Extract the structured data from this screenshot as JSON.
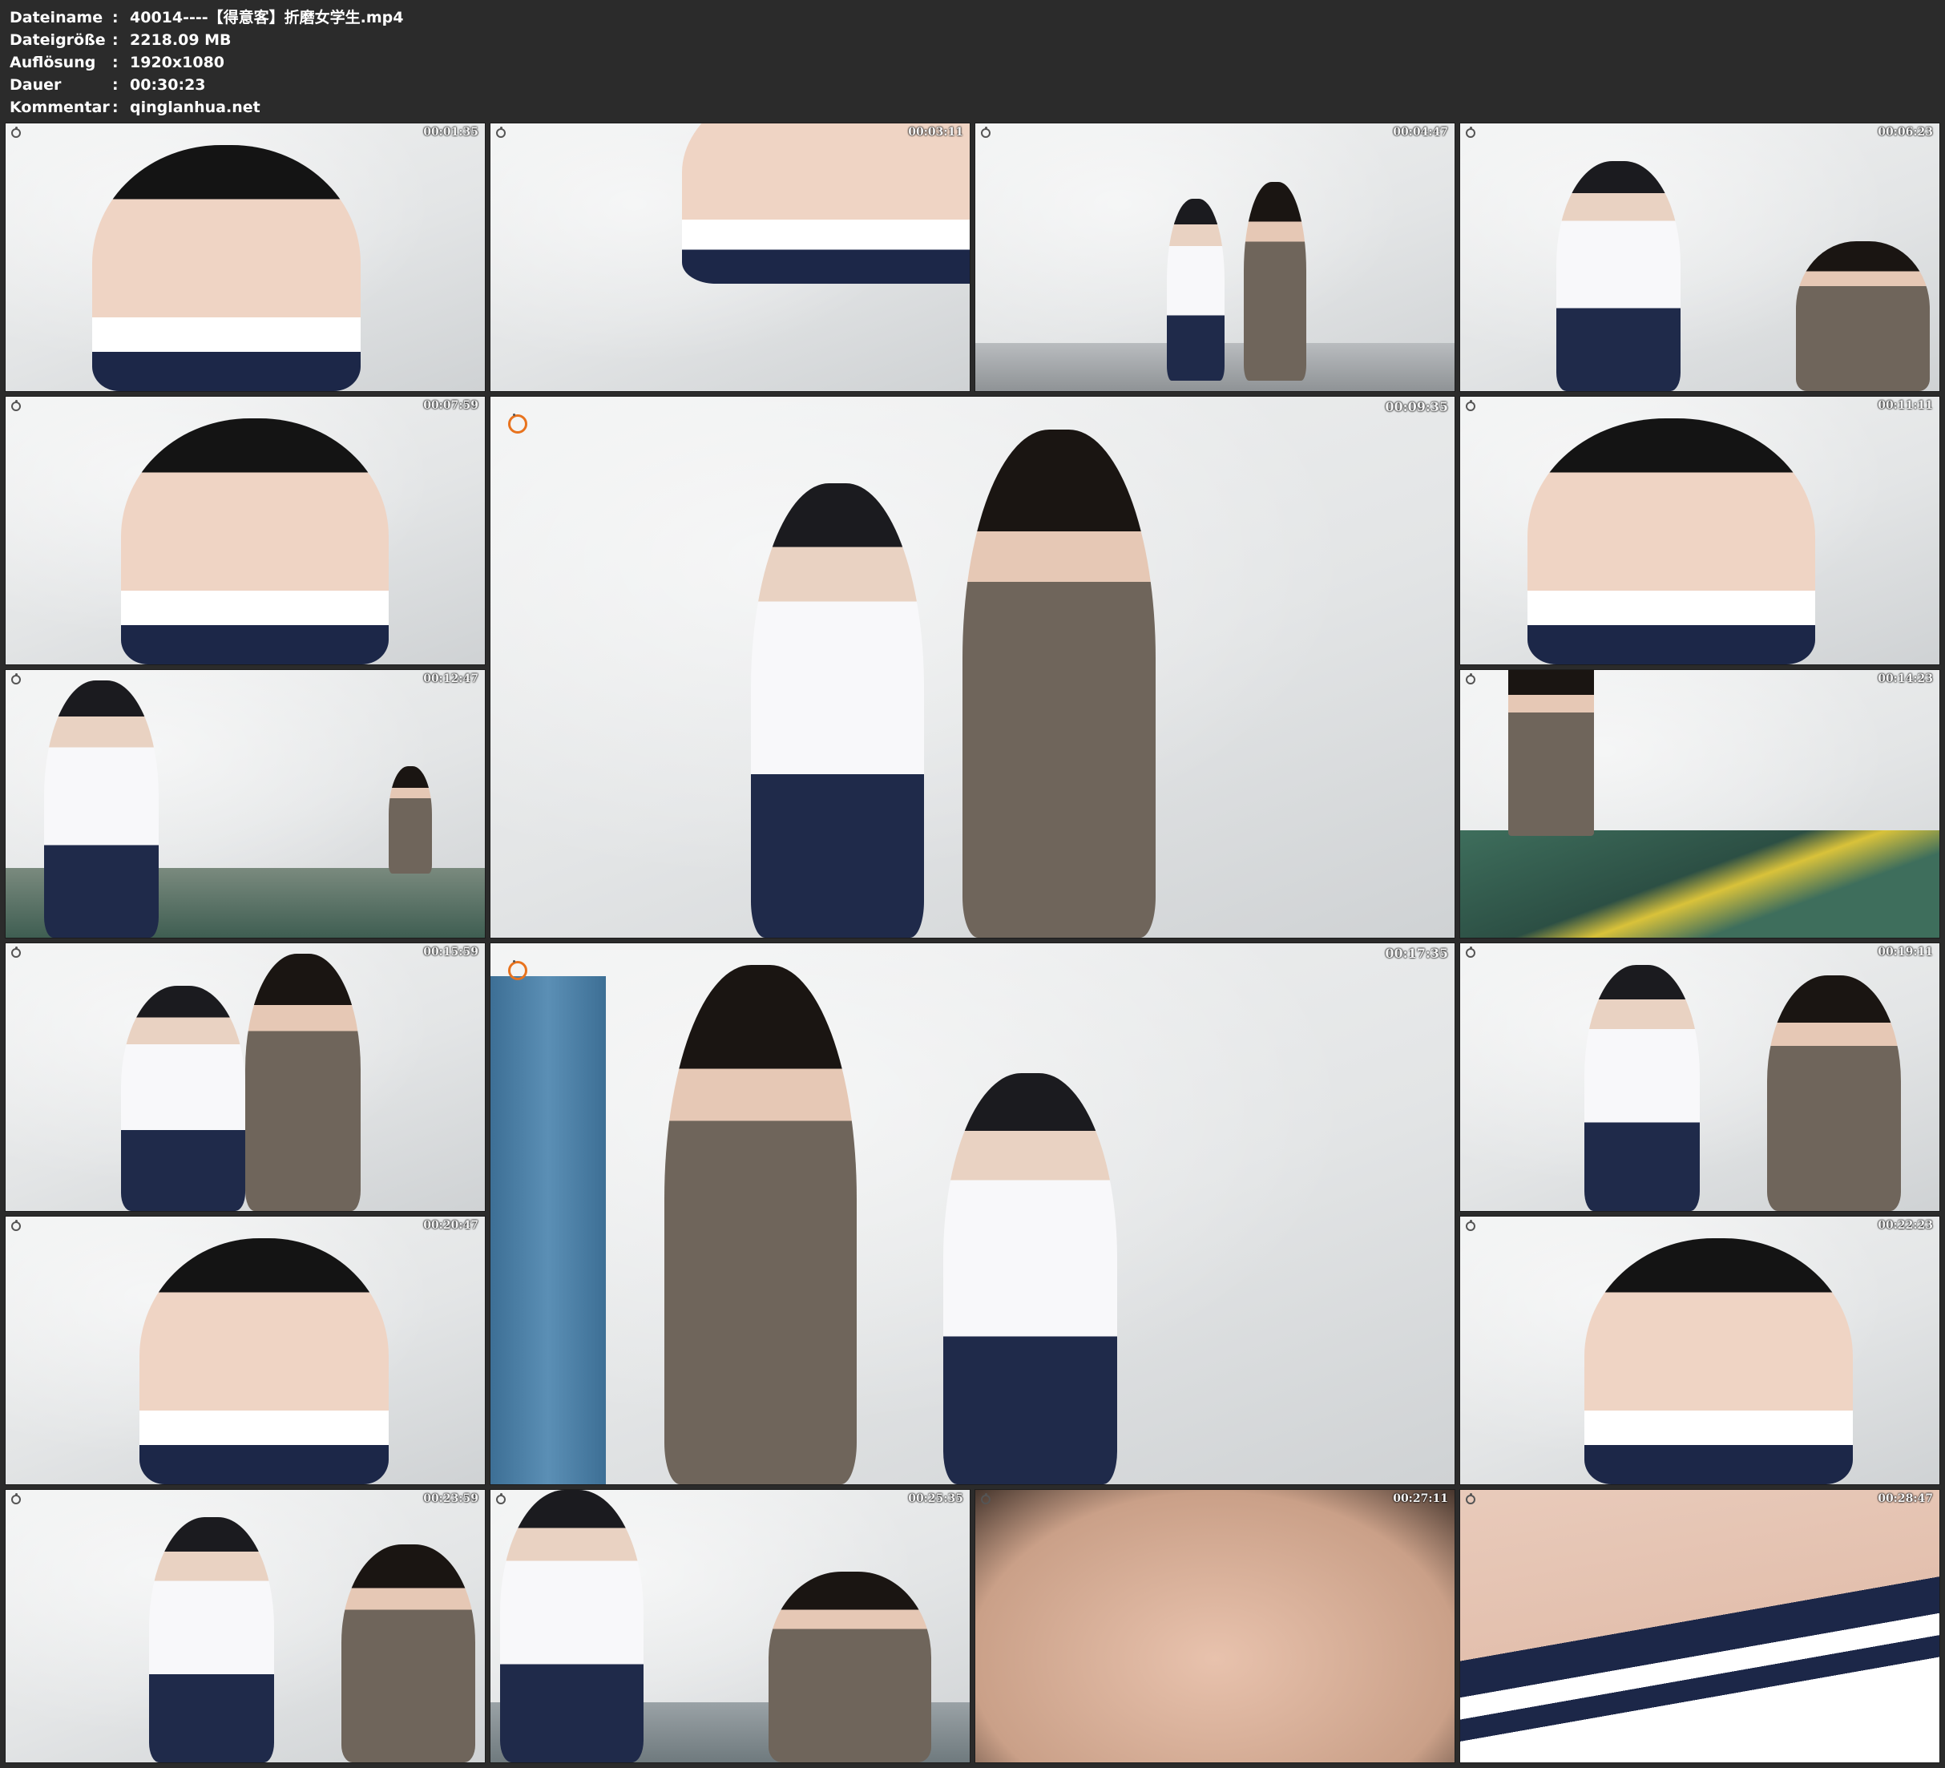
{
  "header": {
    "rows": [
      {
        "label": "Dateiname",
        "sep": ":",
        "value": "40014----【得意客】折磨女学生.mp4"
      },
      {
        "label": "Dateigröße",
        "sep": ":",
        "value": "2218.09 MB"
      },
      {
        "label": "Auflösung",
        "sep": ":",
        "value": "1920x1080"
      },
      {
        "label": "Dauer",
        "sep": ":",
        "value": "00:30:23"
      },
      {
        "label": "Kommentar",
        "sep": ":",
        "value": "qinglanhua.net"
      }
    ]
  },
  "thumbnails": [
    {
      "timestamp": "00:01:35"
    },
    {
      "timestamp": "00:03:11"
    },
    {
      "timestamp": "00:04:47"
    },
    {
      "timestamp": "00:06:23"
    },
    {
      "timestamp": "00:07:59"
    },
    {
      "timestamp": "00:09:35"
    },
    {
      "timestamp": "00:11:11"
    },
    {
      "timestamp": "00:12:47"
    },
    {
      "timestamp": "00:14:23"
    },
    {
      "timestamp": "00:15:59"
    },
    {
      "timestamp": "00:17:35"
    },
    {
      "timestamp": "00:19:11"
    },
    {
      "timestamp": "00:20:47"
    },
    {
      "timestamp": "00:22:23"
    },
    {
      "timestamp": "00:23:59"
    },
    {
      "timestamp": "00:25:35"
    },
    {
      "timestamp": "00:27:11"
    },
    {
      "timestamp": "00:28:47"
    }
  ]
}
